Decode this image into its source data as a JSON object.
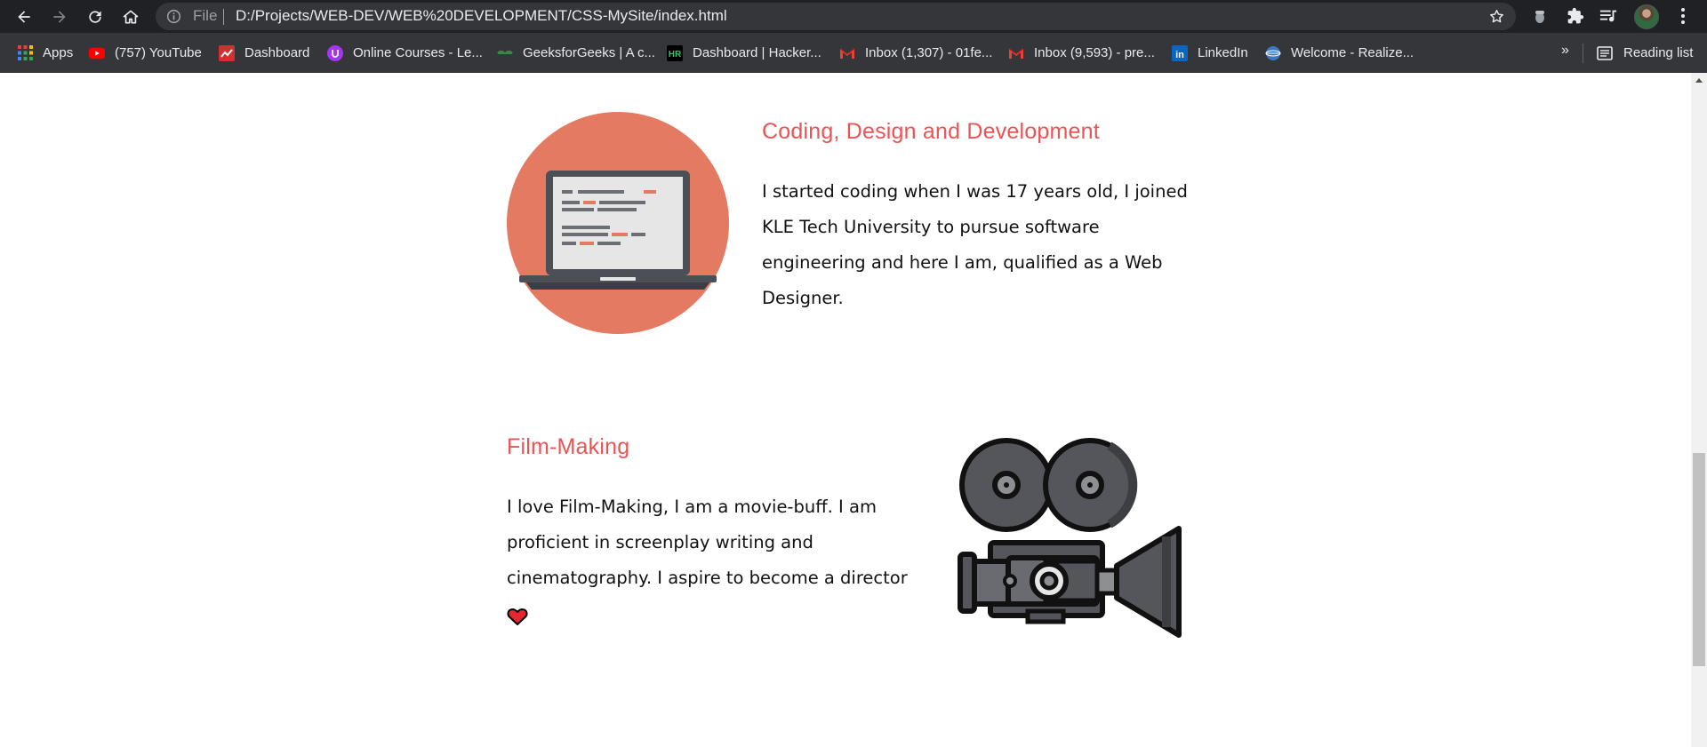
{
  "browser": {
    "file_label": "File",
    "url": "D:/Projects/WEB-DEV/WEB%20DEVELOPMENT/CSS-MySite/index.html",
    "bookmarks": [
      {
        "label": "Apps",
        "icon": "apps-grid-icon"
      },
      {
        "label": "(757) YouTube",
        "icon": "youtube-icon"
      },
      {
        "label": "Dashboard",
        "icon": "dashboard-icon"
      },
      {
        "label": "Online Courses - Le...",
        "icon": "udemy-icon"
      },
      {
        "label": "GeeksforGeeks | A c...",
        "icon": "geeksforgeeks-icon"
      },
      {
        "label": "Dashboard | Hacker...",
        "icon": "hackerrank-icon"
      },
      {
        "label": "Inbox (1,307) - 01fe...",
        "icon": "gmail-icon"
      },
      {
        "label": "Inbox (9,593) - pre...",
        "icon": "gmail-icon"
      },
      {
        "label": "LinkedIn",
        "icon": "linkedin-icon"
      },
      {
        "label": "Welcome - Realize...",
        "icon": "globe-icon"
      }
    ],
    "more_label": "»",
    "reading_list_label": "Reading list"
  },
  "page": {
    "skills": [
      {
        "title": "Coding, Design and Development",
        "text": "I started coding when I was 17 years old, I joined KLE Tech University to pursue software engineering and here I am, qualified as a Web Designer.",
        "image": "laptop-icon"
      },
      {
        "title": "Film-Making",
        "text": "I love Film-Making, I am a movie-buff. I am proficient in screenplay writing and cinematography. I aspire to become a director",
        "image": "film-camera-icon",
        "trailing_icon": "heart-icon"
      }
    ]
  },
  "colors": {
    "accent": "#ea5455",
    "laptop_circle": "#e47a61",
    "browser_bar": "#202124",
    "bookmarks_bar": "#35363a"
  }
}
